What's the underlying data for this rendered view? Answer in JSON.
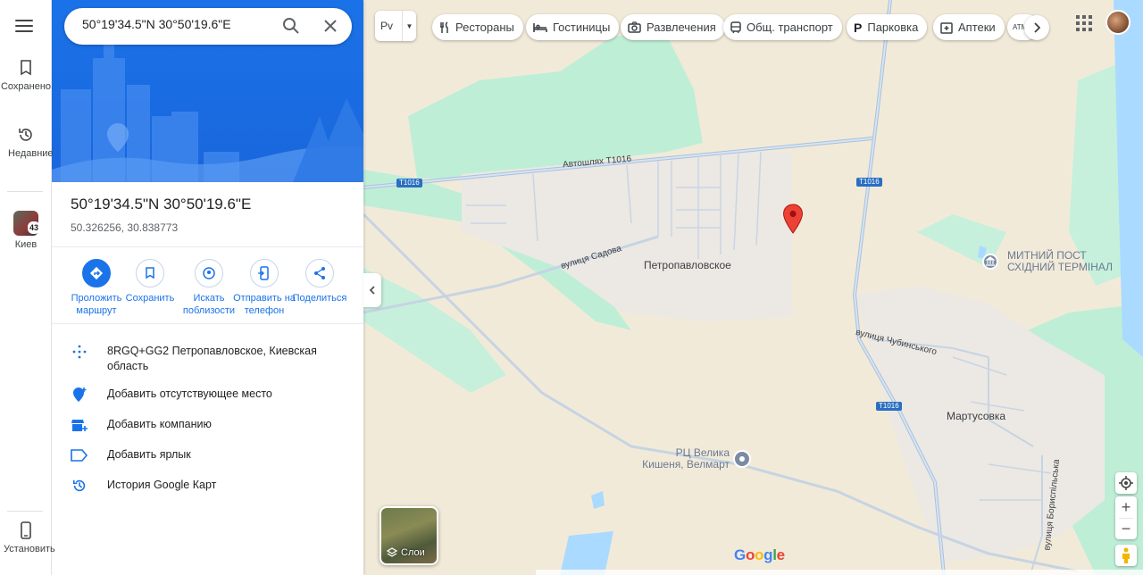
{
  "rail": {
    "saved_label": "Сохранено",
    "recent_label": "Недавние",
    "kiev_label": "Киев",
    "kiev_badge": "43",
    "install_label": "Установить"
  },
  "search": {
    "value": "50°19'34.5\"N 30°50'19.6\"E"
  },
  "place": {
    "title": "50°19'34.5\"N 30°50'19.6\"E",
    "decimal": "50.326256, 30.838773"
  },
  "actions": [
    {
      "label": "Проложить маршрут"
    },
    {
      "label": "Сохранить"
    },
    {
      "label": "Искать поблизости"
    },
    {
      "label": "Отправить на телефон"
    },
    {
      "label": "Поделиться"
    }
  ],
  "details": [
    {
      "icon": "plus-code-icon",
      "text": "8RGQ+GG2 Петропавловское, Киевская область"
    },
    {
      "icon": "add-place-icon",
      "text": "Добавить отсутствующее место"
    },
    {
      "icon": "add-business-icon",
      "text": "Добавить компанию"
    },
    {
      "icon": "label-icon",
      "text": "Добавить ярлык"
    },
    {
      "icon": "history-icon",
      "text": "История Google Карт"
    }
  ],
  "map_type_label": "Рv",
  "chips": [
    {
      "label": "Рестораны",
      "icon": "restaurant-icon"
    },
    {
      "label": "Гостиницы",
      "icon": "hotel-icon"
    },
    {
      "label": "Развлечения",
      "icon": "camera-icon"
    },
    {
      "label": "Общ. транспорт",
      "icon": "transit-icon"
    },
    {
      "label": "Парковка",
      "icon": "parking-icon"
    },
    {
      "label": "Аптеки",
      "icon": "pharmacy-icon"
    },
    {
      "label": "АТМ",
      "icon": "atm-icon"
    }
  ],
  "map": {
    "labels": {
      "highway": "Автошлях Т1016",
      "sadova": "вулиця Садова",
      "village1": "Петропавловское",
      "poi_customs": "МИТНИЙ ПОСТ СХІДНИЙ ТЕРМІНАЛ",
      "chubynskogo": "вулиця Чубинського",
      "village2": "Мартусовка",
      "mall_line1": "РЦ Велика",
      "mall_line2": "Кишеня, Велмарт",
      "boryspilska": "вулиця Бориспільська"
    },
    "shields": [
      "Т1016",
      "Т1016",
      "Т1016"
    ],
    "layers_label": "Слои",
    "logo": "Google"
  },
  "colors": {
    "accent": "#1a73e8",
    "pin": "#ea4335",
    "map_bg": "#f2ead9",
    "green": "#bfeed7",
    "water": "#aadaff"
  }
}
